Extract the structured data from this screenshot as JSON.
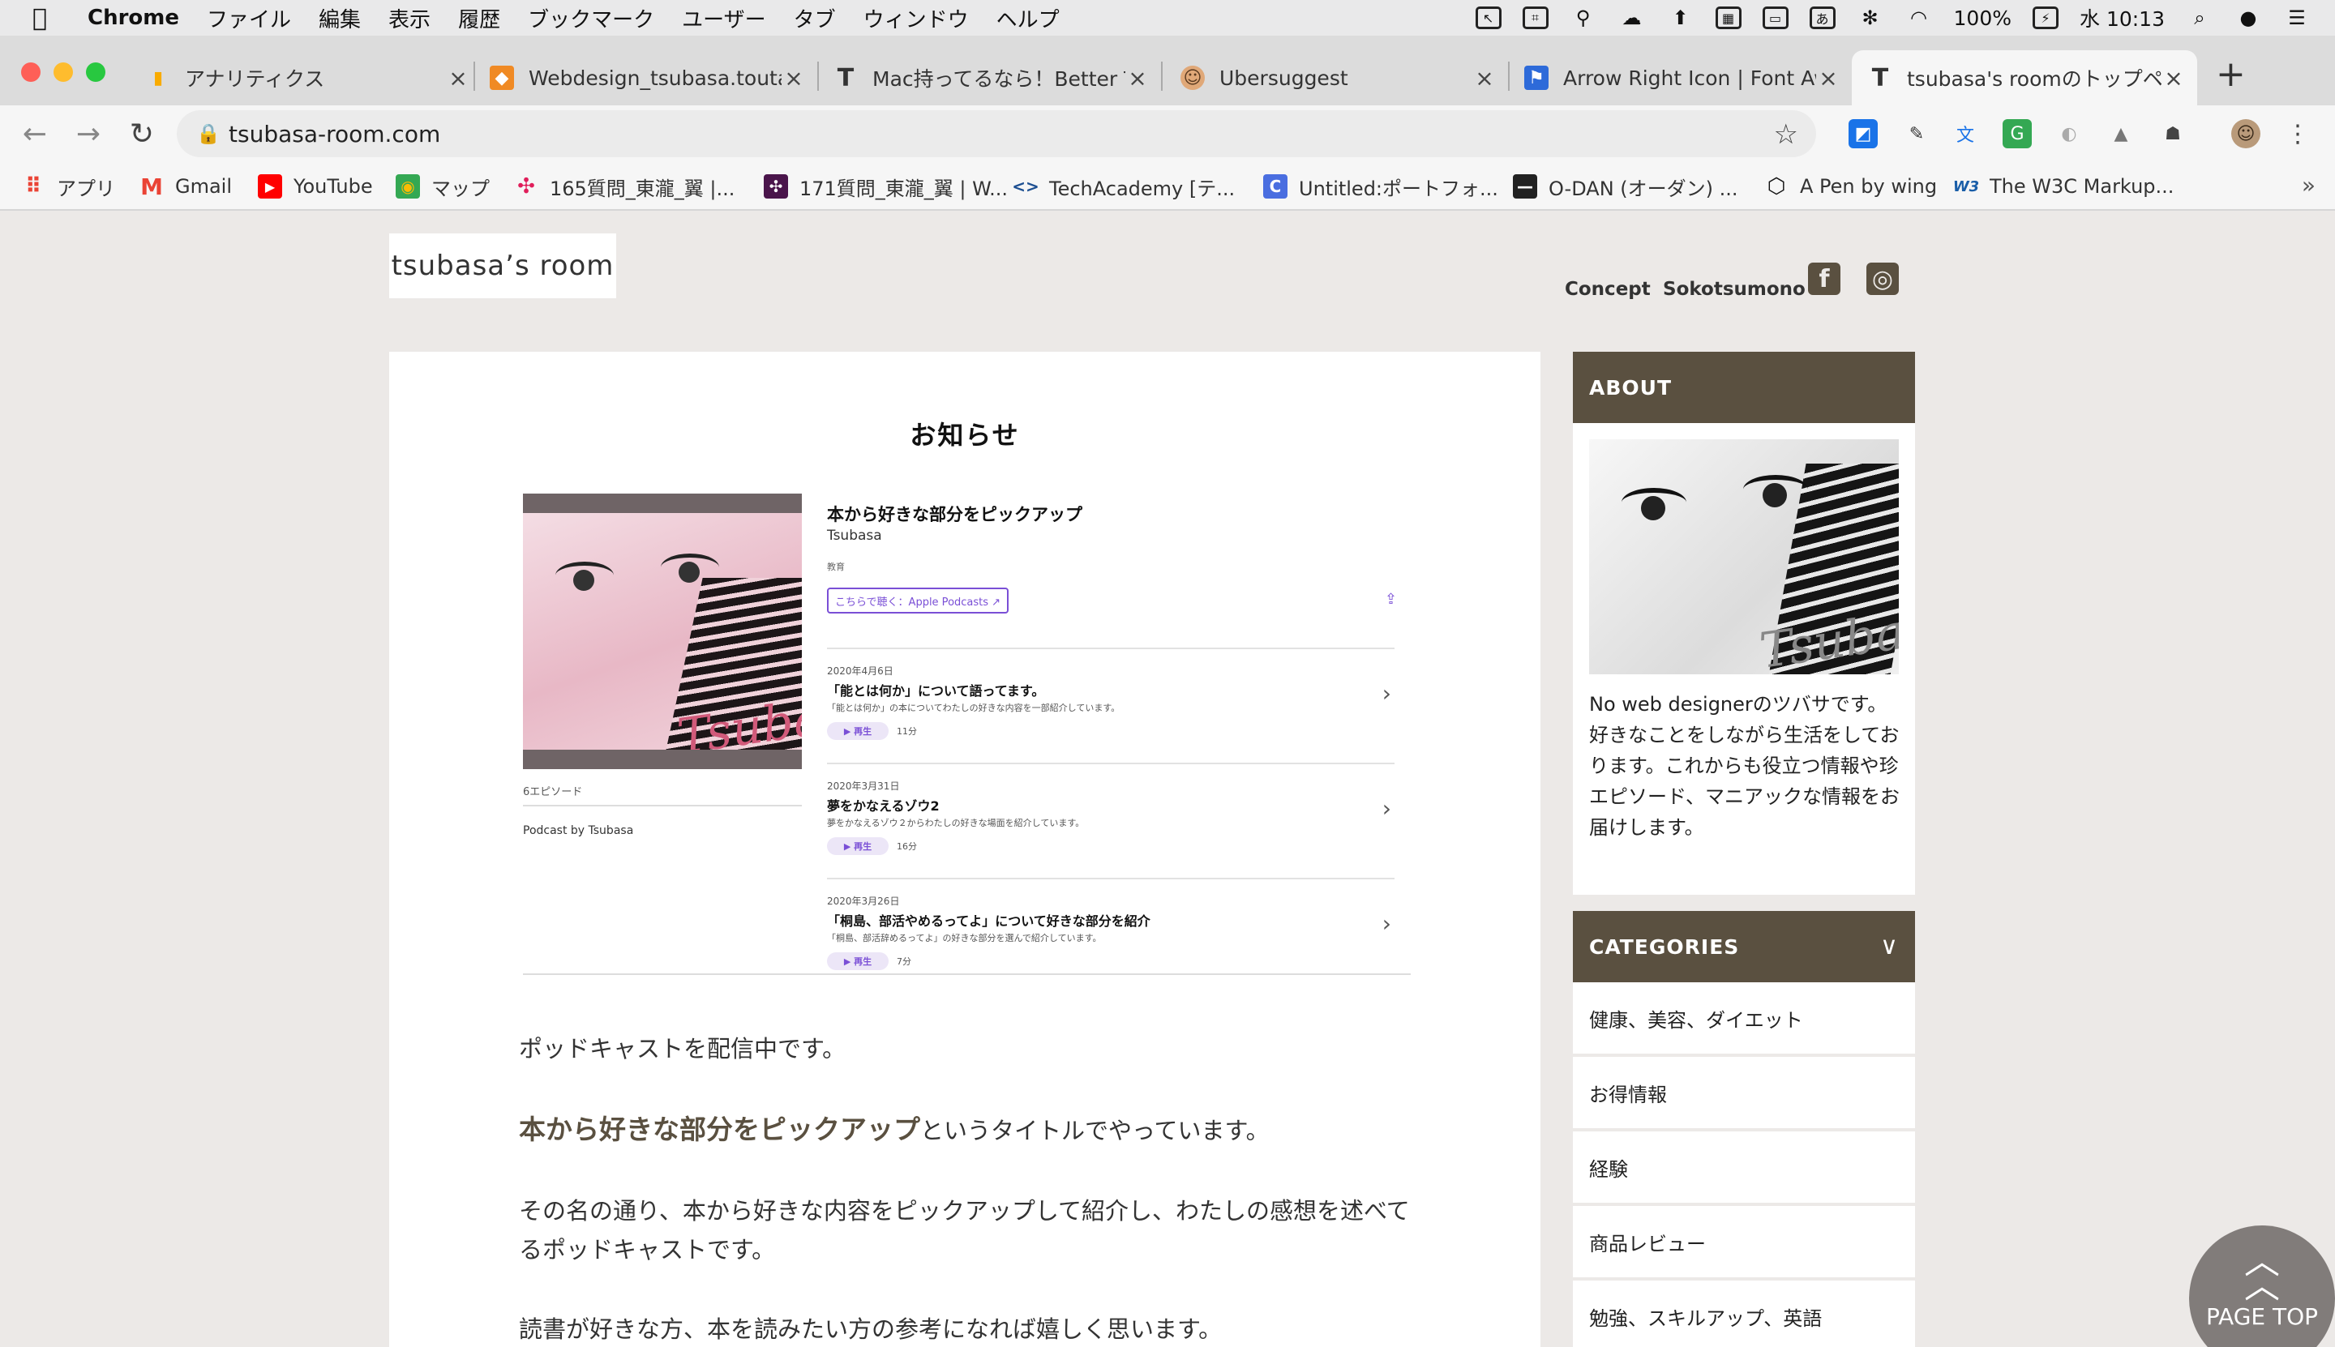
{
  "menubar": {
    "app_name": "Chrome",
    "menus": [
      "ファイル",
      "編集",
      "表示",
      "履歴",
      "ブックマーク",
      "ユーザー",
      "タブ",
      "ウィンドウ",
      "ヘルプ"
    ],
    "battery": "100%",
    "clock": "水 10:13",
    "ime": "あ"
  },
  "tabs": [
    {
      "label": "アナリティクス",
      "icon": "analytics-icon",
      "color": "#f9ab00"
    },
    {
      "label": "Webdesign_tsubasa.toutaki",
      "icon": "cube-icon",
      "color": "#f08a24"
    },
    {
      "label": "Mac持ってるなら！Better To",
      "icon": "t-icon",
      "color": "#333333"
    },
    {
      "label": "Ubersuggest",
      "icon": "face-icon",
      "color": "#c9814c"
    },
    {
      "label": "Arrow Right Icon | Font Awe",
      "icon": "flag-icon",
      "color": "#2d6ad9"
    },
    {
      "label": "tsubasa's roomのトップペー",
      "icon": "t-icon",
      "color": "#333333"
    }
  ],
  "toolbar": {
    "url": "tsubasa-room.com"
  },
  "bookmarks": [
    {
      "label": "アプリ",
      "icon": "apps-grid-icon"
    },
    {
      "label": "Gmail",
      "icon": "gmail-icon"
    },
    {
      "label": "YouTube",
      "icon": "youtube-icon"
    },
    {
      "label": "マップ",
      "icon": "maps-icon"
    },
    {
      "label": "165質問_東瀧_翼 |...",
      "icon": "slack-icon"
    },
    {
      "label": "171質問_東瀧_翼 | W...",
      "icon": "slack-dark-icon"
    },
    {
      "label": "TechAcademy [テ...",
      "icon": "code-icon"
    },
    {
      "label": "Untitled:ポートフォ...",
      "icon": "c-icon"
    },
    {
      "label": "O-DAN (オーダン) ...",
      "icon": "odan-icon"
    },
    {
      "label": "A Pen by wing",
      "icon": "codepen-icon"
    },
    {
      "label": "The W3C Markup...",
      "icon": "w3c-icon"
    }
  ],
  "site": {
    "logo": "tsubasa’s room",
    "nav": [
      "Concept",
      "Sokotsumono"
    ],
    "facebook_glyph": "f",
    "instagram_glyph": "◎"
  },
  "main": {
    "title": "お知らせ",
    "podcast": {
      "title": "本から好きな部分をピックアップ",
      "author": "Tsubasa",
      "genre": "教育",
      "link": "こちらで聴く：Apple Podcasts ↗",
      "episode_count": "6エピソード",
      "byline": "Podcast by Tsubasa",
      "cover_signature": "Tsubasa",
      "episodes": [
        {
          "date": "2020年4月6日",
          "title": "「能とは何か」について語ってます。",
          "desc": "「能とは何か」の本についてわたしの好きな内容を一部紹介しています。",
          "play": "▶ 再生",
          "duration": "11分"
        },
        {
          "date": "2020年3月31日",
          "title": "夢をかなえるゾウ2",
          "desc": "夢をかなえるゾウ２からわたしの好きな場面を紹介しています。",
          "play": "▶ 再生",
          "duration": "16分"
        },
        {
          "date": "2020年3月26日",
          "title": "「桐島、部活やめるってよ」について好きな部分を紹介",
          "desc": "「桐島、部活辞めるってよ」の好きな部分を選んで紹介しています。",
          "play": "▶ 再生",
          "duration": "7分"
        }
      ]
    },
    "para1": "ポッドキャストを配信中です。",
    "para2_strong": "本から好きな部分をピックアップ",
    "para2_rest": "というタイトルでやっています。",
    "para3": "その名の通り、本から好きな内容をピックアップして紹介し、わたしの感想を述べてるポッドキャストです。",
    "para4": "読書が好きな方、本を読みたい方の参考になれば嬉しく思います。"
  },
  "sidebar": {
    "about_heading": "ABOUT",
    "about_signature": "Tsubasa",
    "about_text": "No web designerのツバサです。好きなことをしながら生活をしております。これからも役立つ情報や珍エピソード、マニアックな情報をお届けします。",
    "categories_heading": "CATEGORIES",
    "categories": [
      "健康、美容、ダイエット",
      "お得情報",
      "経験",
      "商品レビュー",
      "勉強、スキルアップ、英語"
    ]
  },
  "pagetop": {
    "label": "PAGE TOP"
  },
  "colors": {
    "brand_brown": "#5a5040",
    "page_bg": "#ece9e7",
    "podcast_purple": "#7a4fd6"
  }
}
